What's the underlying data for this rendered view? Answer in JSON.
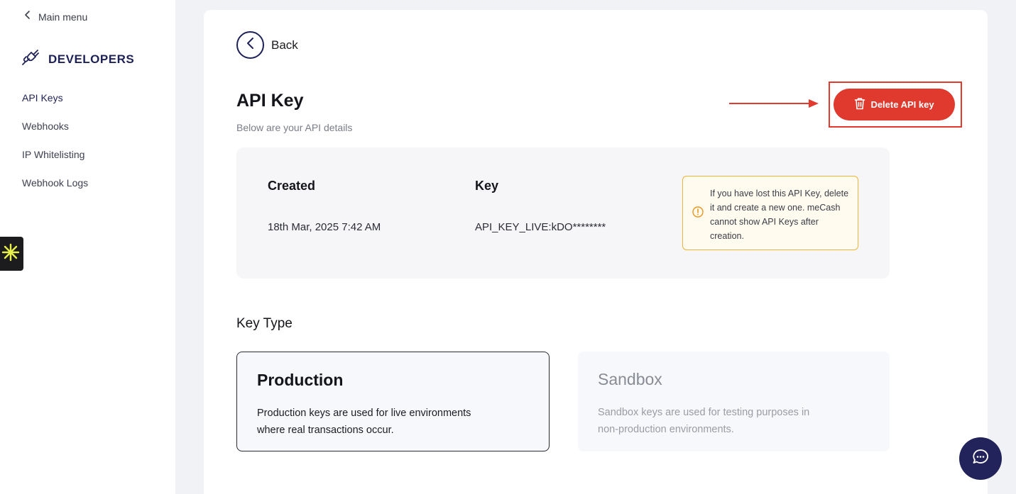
{
  "sidebar": {
    "back_label": "Main menu",
    "section_title": "DEVELOPERS",
    "items": [
      {
        "label": "API Keys"
      },
      {
        "label": "Webhooks"
      },
      {
        "label": "IP Whitelisting"
      },
      {
        "label": "Webhook Logs"
      }
    ]
  },
  "header": {
    "back_label": "Back",
    "title": "API Key",
    "subtitle": "Below are your API details",
    "delete_label": "Delete API key"
  },
  "details": {
    "created_label": "Created",
    "created_value": "18th Mar, 2025 7:42 AM",
    "key_label": "Key",
    "key_value": "API_KEY_LIVE:kDO********",
    "notice": "If you have lost this API Key, delete it and create a new one. meCash cannot show API Keys after creation."
  },
  "key_type": {
    "title": "Key Type",
    "options": [
      {
        "title": "Production",
        "description": "Production keys are used for live environments where real transactions occur.",
        "selected": true
      },
      {
        "title": "Sandbox",
        "description": "Sandbox keys are used for testing purposes in non-production environments.",
        "selected": false
      }
    ]
  },
  "colors": {
    "brand_navy": "#1e2156",
    "danger": "#e03a2e",
    "warning_border": "#f0b43a",
    "warning_bg": "#fffbef"
  },
  "icons": [
    "chevron-left-icon",
    "plug-icon",
    "trash-icon",
    "warning-circle-icon",
    "chat-icon",
    "asterisk-icon",
    "arrow-right-icon"
  ]
}
